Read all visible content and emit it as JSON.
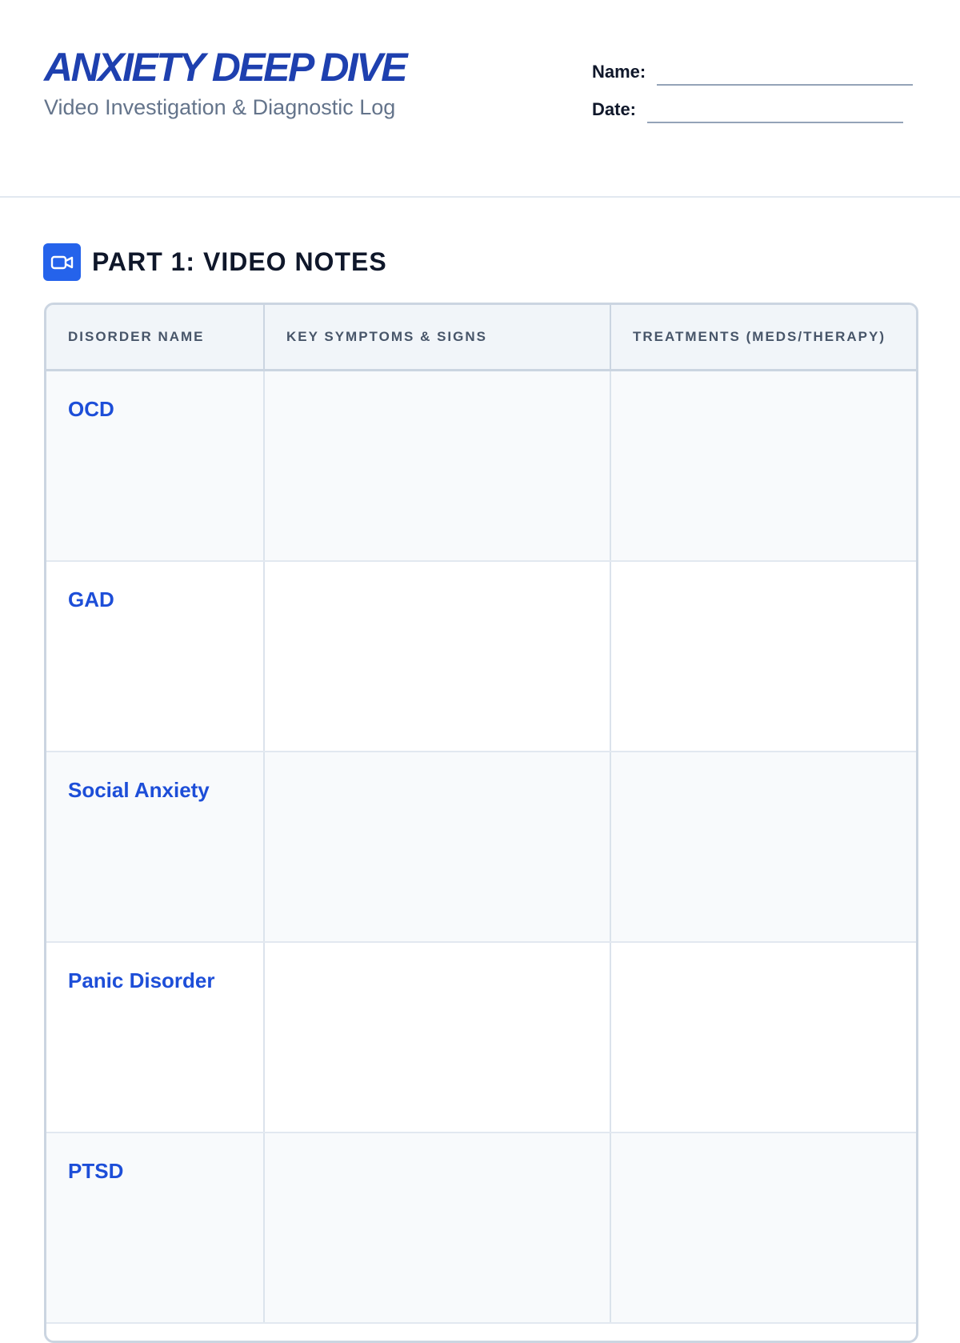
{
  "header": {
    "title": "ANXIETY DEEP DIVE",
    "subtitle": "Video Investigation & Diagnostic Log",
    "name_label": "Name:",
    "date_label": "Date:"
  },
  "section": {
    "title": "PART 1: VIDEO NOTES",
    "icon": "video-camera-icon"
  },
  "table": {
    "columns": [
      "DISORDER NAME",
      "KEY SYMPTOMS & SIGNS",
      "TREATMENTS (MEDS/THERAPY)"
    ],
    "rows": [
      {
        "name": "OCD",
        "symptoms": "",
        "treatments": ""
      },
      {
        "name": "GAD",
        "symptoms": "",
        "treatments": ""
      },
      {
        "name": "Social Anxiety",
        "symptoms": "",
        "treatments": ""
      },
      {
        "name": "Panic Disorder",
        "symptoms": "",
        "treatments": ""
      },
      {
        "name": "PTSD",
        "symptoms": "",
        "treatments": ""
      }
    ]
  },
  "colors": {
    "accent": "#1e40af",
    "icon_bg": "#2563eb",
    "row_label": "#1d4ed8",
    "border": "#cbd5e1"
  }
}
